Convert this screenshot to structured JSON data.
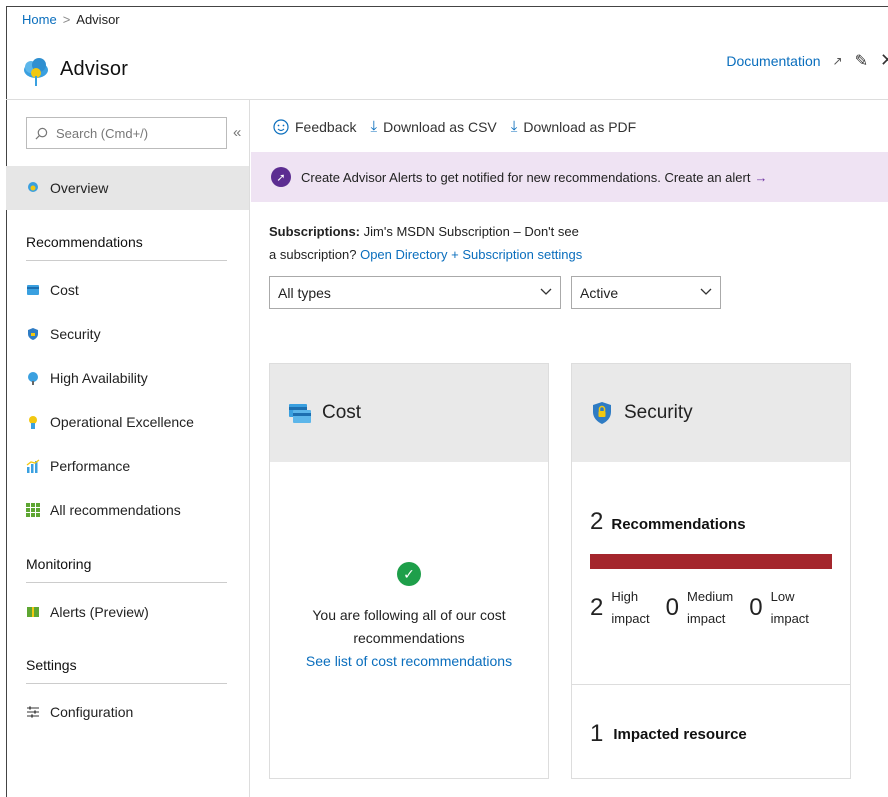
{
  "breadcrumb": {
    "home": "Home",
    "separator": ">",
    "current": "Advisor"
  },
  "header": {
    "title": "Advisor",
    "documentation": "Documentation"
  },
  "sidebar": {
    "search_placeholder": "Search (Cmd+/)",
    "collapse": "«",
    "overview": "Overview",
    "sections": {
      "recommendations": "Recommendations",
      "monitoring": "Monitoring",
      "settings": "Settings"
    },
    "items": [
      {
        "label": "Cost",
        "icon": "cost-icon"
      },
      {
        "label": "Security",
        "icon": "security-icon"
      },
      {
        "label": "High Availability",
        "icon": "high-availability-icon"
      },
      {
        "label": "Operational Excellence",
        "icon": "operational-excellence-icon"
      },
      {
        "label": "Performance",
        "icon": "performance-icon"
      },
      {
        "label": "All recommendations",
        "icon": "grid-icon"
      }
    ],
    "alerts": "Alerts (Preview)",
    "configuration": "Configuration"
  },
  "toolbar": {
    "feedback": "Feedback",
    "download_csv": "Download as CSV",
    "download_pdf": "Download as PDF"
  },
  "banner": {
    "text": "Create Advisor Alerts to get notified for new recommendations. Create an alert",
    "arrow": "→"
  },
  "subscriptions": {
    "label": "Subscriptions:",
    "value": "Jim's MSDN Subscription – Don't see a subscription?",
    "link": "Open Directory + Subscription settings"
  },
  "filters": {
    "type": "All types",
    "status": "Active"
  },
  "cost_card": {
    "title": "Cost",
    "message_line1": "You are following all of our cost",
    "message_line2": "recommendations",
    "link": "See list of cost recommendations"
  },
  "security_card": {
    "title": "Security",
    "recommendations_count": "2",
    "recommendations_label": "Recommendations",
    "high_fraction": 1.0,
    "high": {
      "count": "2",
      "line1": "High",
      "line2": "impact"
    },
    "medium": {
      "count": "0",
      "line1": "Medium",
      "line2": "impact"
    },
    "low": {
      "count": "0",
      "line1": "Low",
      "line2": "impact"
    },
    "impacted_count": "1",
    "impacted_label": "Impacted resource"
  },
  "colors": {
    "accent": "#0a6ebd",
    "high_impact": "#a4262c",
    "banner_bg": "#efe3f3",
    "success": "#1e9f4a"
  }
}
